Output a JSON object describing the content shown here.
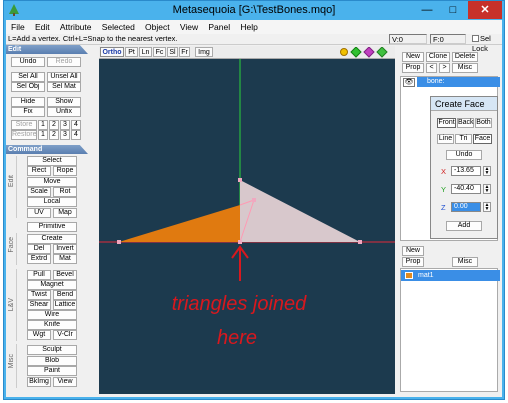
{
  "window": {
    "title": "Metasequoia [G:\\TestBones.mqo]",
    "controls": {
      "minimize": "—",
      "maximize": "□",
      "close": "✕"
    }
  },
  "menu": [
    "File",
    "Edit",
    "Attribute",
    "Selected",
    "Object",
    "View",
    "Panel",
    "Help"
  ],
  "status": {
    "hint": "L=Add a vertex.  Ctrl+L=Snap to the nearest vertex.",
    "vertex_count": "V:0",
    "face_count": "F:0",
    "sel_lock": "Sel Lock"
  },
  "left_panel": {
    "edit_header": "Edit",
    "undo": "Undo",
    "redo": "Redo",
    "sel_all": "Sel All",
    "unsel_all": "Unsel All",
    "sel_obj": "Sel Obj",
    "sel_mat": "Sel Mat",
    "hide": "Hide",
    "show": "Show",
    "fix": "Fix",
    "unfix": "Unfix",
    "store": "Store",
    "restore": "Restore",
    "slots": [
      "1",
      "2",
      "3",
      "4"
    ],
    "command_header": "Command",
    "groups": {
      "edit": "Edit",
      "face": "Face",
      "lv": "L&V",
      "misc": "Misc"
    },
    "commands": {
      "select": "Select",
      "rect": "Rect",
      "rope": "Rope",
      "move": "Move",
      "scale": "Scale",
      "rot": "Rot",
      "local": "Local",
      "uv": "UV",
      "map": "Map",
      "primitive": "Primitive",
      "create": "Create",
      "del": "Del",
      "invert": "Invert",
      "extrd": "Extrd",
      "mat": "Mat",
      "pull": "Pull",
      "bevel": "Bevel",
      "magnet": "Magnet",
      "twist": "Twist",
      "bend": "Bend",
      "shear": "Shear",
      "lattice": "Lattice",
      "wire": "Wire",
      "knife": "Knife",
      "wgt": "Wgt",
      "vclr": "V-Clr",
      "sculpt": "Sculpt",
      "blob": "Blob",
      "paint": "Paint",
      "bkimg": "BkImg",
      "view": "View"
    }
  },
  "viewport": {
    "tabs": [
      "Ortho",
      "Pt",
      "Ln",
      "Fc",
      "Sl",
      "Fr",
      "Img"
    ],
    "active_tab": "Ortho",
    "annotation": [
      "triangles joined",
      "here"
    ],
    "colors": {
      "background": "#1c3a4e",
      "selected_face": "#e07a10",
      "face": "#d8c8cc",
      "axis_x": "#e02a3a",
      "axis_y": "#2ad23a",
      "annotation": "#d8181e"
    }
  },
  "right_panel": {
    "object_buttons": {
      "new": "New",
      "clone": "Clone",
      "delete": "Delete",
      "prop": "Prop",
      "prev": "<",
      "next": ">",
      "misc": "Misc"
    },
    "objects": [
      {
        "name": "bone:"
      }
    ],
    "material_buttons": {
      "new": "New",
      "prop": "Prop",
      "misc": "Misc"
    },
    "materials": [
      {
        "name": "mat1",
        "color": "#e08a1f"
      }
    ]
  },
  "create_face": {
    "title": "Create Face",
    "modes": [
      "Front",
      "Back",
      "Both"
    ],
    "types": [
      "Line",
      "Tri",
      "Face"
    ],
    "active_type": "Face",
    "undo": "Undo",
    "x_label": "X",
    "y_label": "Y",
    "z_label": "Z",
    "x_value": "-13.65",
    "y_value": "-40.40",
    "z_value": "0.00",
    "add": "Add"
  }
}
